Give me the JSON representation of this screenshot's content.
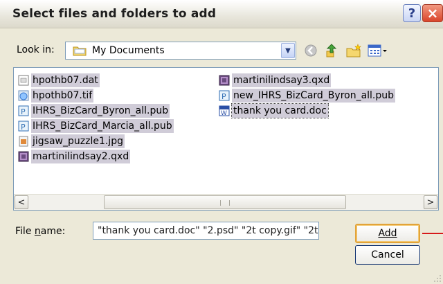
{
  "window": {
    "title": "Select files and folders to add",
    "help_label": "?",
    "close_label": "×"
  },
  "lookin": {
    "label": "Look in:",
    "value": "My Documents"
  },
  "files": [
    {
      "name": "hpothb07.dat",
      "icon": "dat-file-icon"
    },
    {
      "name": "hpothb07.tif",
      "icon": "image-file-icon"
    },
    {
      "name": "IHRS_BizCard_Byron_all.pub",
      "icon": "publisher-file-icon"
    },
    {
      "name": "IHRS_BizCard_Marcia_all.pub",
      "icon": "publisher-file-icon"
    },
    {
      "name": "jigsaw_puzzle1.jpg",
      "icon": "image-file-icon"
    },
    {
      "name": "martinilindsay2.qxd",
      "icon": "quark-file-icon"
    },
    {
      "name": "martinilindsay3.qxd",
      "icon": "quark-file-icon"
    },
    {
      "name": "new_IHRS_BizCard_Byron_all.pub",
      "icon": "publisher-file-icon"
    },
    {
      "name": "thank you card.doc",
      "icon": "word-file-icon"
    }
  ],
  "scrollbar": {
    "left_arrow": "<",
    "right_arrow": ">"
  },
  "filename": {
    "label": "File name:",
    "value": "\"thank you card.doc\" \"2.psd\" \"2t copy.gif\" \"2t."
  },
  "buttons": {
    "add": "Add",
    "cancel": "Cancel"
  },
  "colors": {
    "selection": "#d0ccd8",
    "dialog_bg": "#ece9d8",
    "annotation_line": "#d61a1a"
  }
}
